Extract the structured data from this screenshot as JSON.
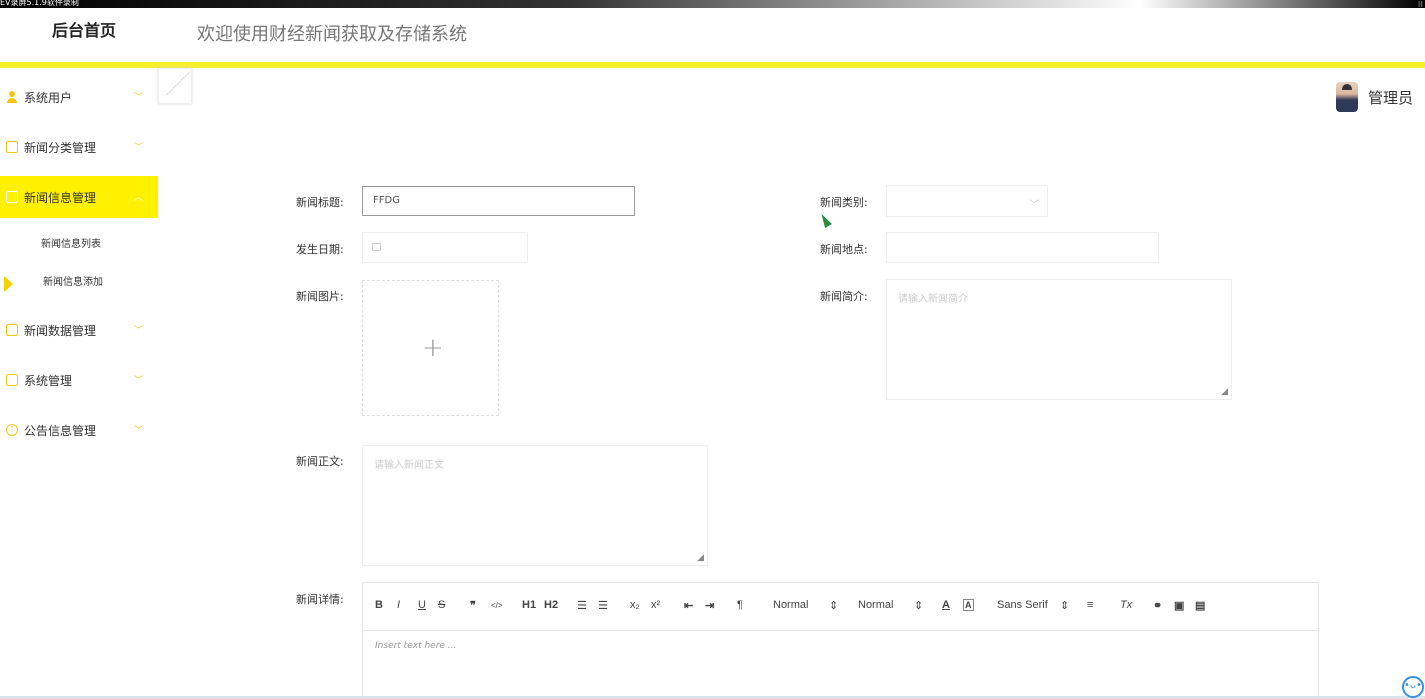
{
  "recorder": {
    "title": "EV录屏5.1.9软件录制"
  },
  "header": {
    "brand": "后台首页",
    "title": "欢迎使用财经新闻获取及存储系统"
  },
  "user": {
    "name": "管理员"
  },
  "sidebar": {
    "items": [
      {
        "label": "系统用户",
        "icon": "user-icon"
      },
      {
        "label": "新闻分类管理",
        "icon": "edit-icon"
      },
      {
        "label": "新闻信息管理",
        "icon": "edit-icon",
        "active": true
      },
      {
        "label": "新闻数据管理",
        "icon": "edit-icon"
      },
      {
        "label": "系统管理",
        "icon": "image-icon"
      },
      {
        "label": "公告信息管理",
        "icon": "info-icon"
      }
    ],
    "sub_items": [
      {
        "label": "新闻信息列表"
      },
      {
        "label": "新闻信息添加",
        "current": true
      }
    ]
  },
  "form": {
    "title_label": "新闻标题:",
    "title_value": "FFDG",
    "category_label": "新闻类别:",
    "date_label": "发生日期:",
    "location_label": "新闻地点:",
    "image_label": "新闻图片:",
    "summary_label": "新闻简介:",
    "summary_placeholder": "请输入新闻简介",
    "body_label": "新闻正文:",
    "body_placeholder": "请输入新闻正文",
    "detail_label": "新闻详情:",
    "editor": {
      "toolbar": [
        "B",
        "I",
        "U",
        "S",
        "❞",
        "</>",
        "H1",
        "H2",
        "OL",
        "UL",
        "x₂",
        "x²",
        "outdent",
        "indent",
        "¶",
        "Normal",
        "Normal",
        "A",
        "A",
        "Sans Serif",
        "align",
        "Tx",
        "link",
        "image",
        "video"
      ],
      "size_select": "Normal",
      "header_select": "Normal",
      "font_select": "Sans Serif",
      "placeholder": "Insert text here ..."
    }
  },
  "colors": {
    "accent": "#fff100",
    "bar": "#f7ef2a",
    "icon": "#f5c518"
  }
}
